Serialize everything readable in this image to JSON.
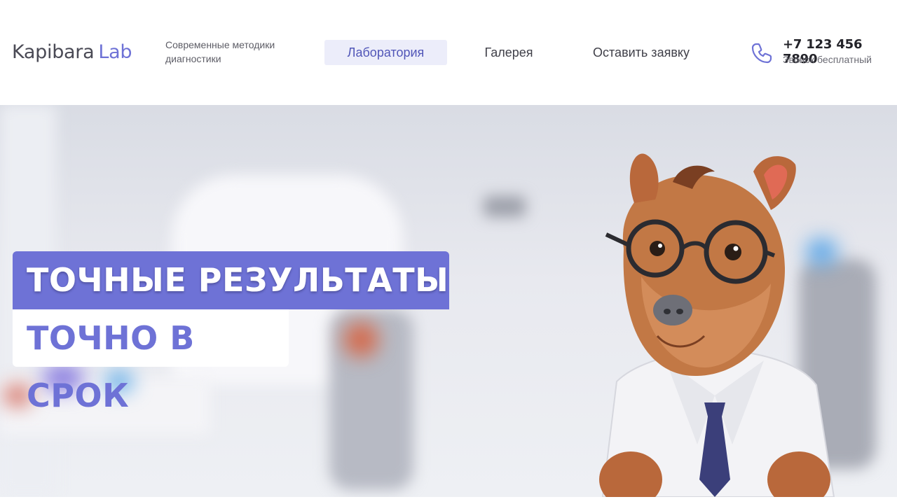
{
  "header": {
    "logo": {
      "part1": "Kapibara",
      "part2": "Lab"
    },
    "tagline": "Современные методики диагностики",
    "nav": [
      {
        "label": "Лаборатория",
        "active": true
      },
      {
        "label": "Галерея",
        "active": false
      },
      {
        "label": "Оставить заявку",
        "active": false
      }
    ],
    "contact": {
      "icon": "phone-icon",
      "phone": "+7 123 456 7890",
      "note": "Звонок бесплатный"
    }
  },
  "hero": {
    "headline_line1": "ТОЧНЫЕ РЕЗУЛЬТАТЫ",
    "headline_line2": "ТОЧНО В СРОК",
    "mascot": "capybara-scientist-illustration"
  },
  "colors": {
    "accent": "#6e72d6",
    "nav_active_bg": "#ecedfa",
    "text_dark": "#3f3f48"
  }
}
